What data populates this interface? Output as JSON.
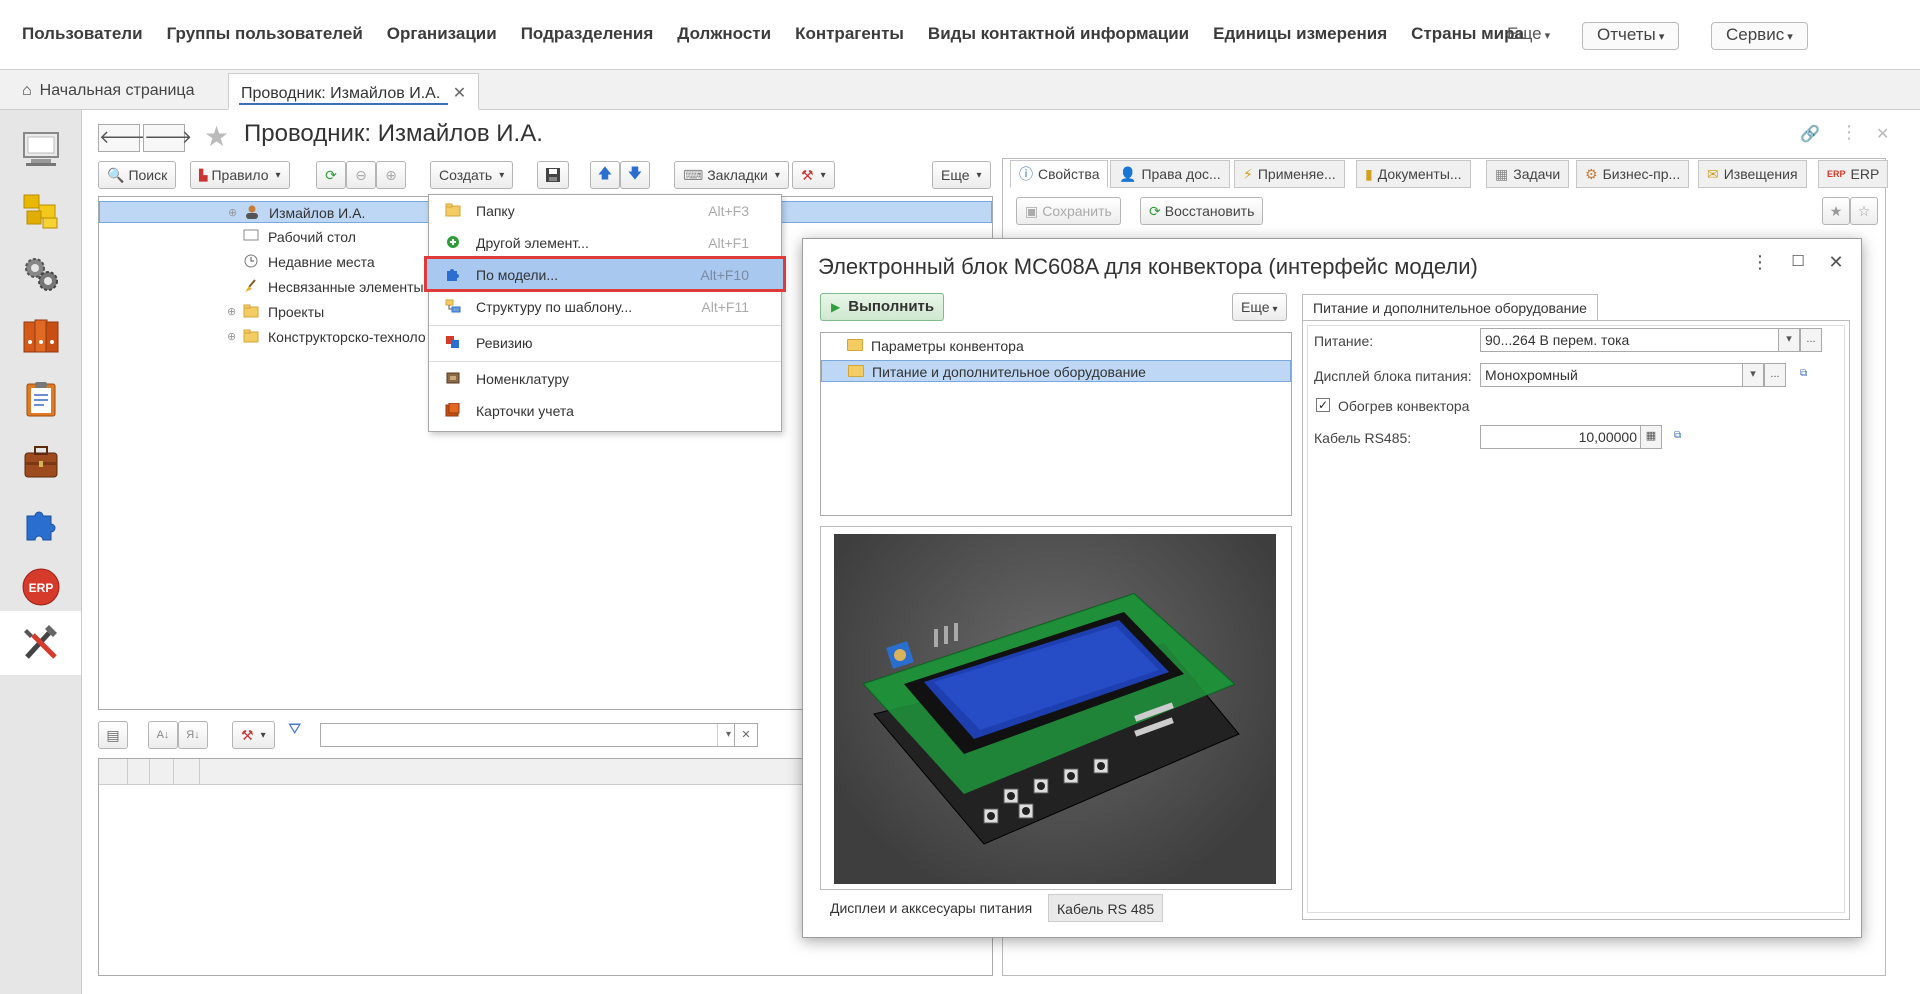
{
  "topmenu": {
    "items": [
      "Пользователи",
      "Группы пользователей",
      "Организации",
      "Подразделения",
      "Должности",
      "Контрагенты",
      "Виды контактной информации",
      "Единицы измерения",
      "Страны мира"
    ],
    "more_label": "Еще",
    "reports_label": "Отчеты",
    "service_label": "Сервис"
  },
  "window_tabs": {
    "home_label": "Начальная страница",
    "active_label": "Проводник: Измайлов И.А."
  },
  "sidebar": {
    "items": [
      {
        "icon": "desktop-icon"
      },
      {
        "icon": "cubes-icon"
      },
      {
        "icon": "gears-icon"
      },
      {
        "icon": "binders-icon"
      },
      {
        "icon": "clipboard-icon"
      },
      {
        "icon": "briefcase-icon"
      },
      {
        "icon": "puzzle-icon"
      },
      {
        "icon": "erp-icon",
        "label": "ERP"
      },
      {
        "icon": "tools-icon"
      }
    ]
  },
  "form": {
    "title": "Проводник: Измайлов И.А.",
    "toolbar": {
      "search_label": "Поиск",
      "rule_label": "Правило",
      "create_label": "Создать",
      "bookmarks_label": "Закладки",
      "more_label": "Еще"
    },
    "tree": [
      {
        "label": "Измайлов И.А.",
        "selected": true,
        "expandable": true
      },
      {
        "label": "Рабочий стол",
        "selected": false,
        "expandable": false
      },
      {
        "label": "Недавние места",
        "selected": false,
        "expandable": false
      },
      {
        "label": "Несвязанные элементы",
        "selected": false,
        "expandable": false
      },
      {
        "label": "Проекты",
        "selected": false,
        "expandable": true
      },
      {
        "label": "Конструкторско-техноло",
        "selected": false,
        "expandable": true
      }
    ],
    "filter_value": ""
  },
  "right_panel": {
    "tabs": [
      "Свойства",
      "Права дос...",
      "Применяе...",
      "Документы...",
      "Задачи",
      "Бизнес-пр...",
      "Извещения",
      "ERP"
    ],
    "save_label": "Сохранить",
    "restore_label": "Восстановить"
  },
  "create_menu": {
    "items": [
      {
        "label": "Папку",
        "shortcut": "Alt+F3",
        "icon": "folder-icon"
      },
      {
        "label": "Другой элемент...",
        "shortcut": "Alt+F1",
        "icon": "add-icon"
      },
      {
        "label": "По модели...",
        "shortcut": "Alt+F10",
        "icon": "puzzle-icon",
        "highlighted": true
      },
      {
        "label": "Структуру по шаблону...",
        "shortcut": "Alt+F11",
        "icon": "structure-icon"
      },
      {
        "label": "Ревизию",
        "shortcut": "",
        "icon": "revision-icon"
      },
      {
        "label": "Номенклатуру",
        "shortcut": "",
        "icon": "nomenclature-icon"
      },
      {
        "label": "Карточки учета",
        "shortcut": "",
        "icon": "cards-icon"
      }
    ]
  },
  "dialog": {
    "title": "Электронный блок MC608A для конвектора (интерфейс модели)",
    "run_label": "Выполнить",
    "more_label": "Еще",
    "params": [
      {
        "label": "Параметры конвентора",
        "selected": false
      },
      {
        "label": "Питание и дополнительное оборудование",
        "selected": true
      }
    ],
    "bottom_tabs": [
      "Дисплеи и акксесуары питания",
      "Кабель RS 485"
    ],
    "fields_tab": "Питание и дополнительное оборудование",
    "fields": {
      "power_label": "Питание:",
      "power_value": "90...264 В перем. тока",
      "display_label": "Дисплей блока питания:",
      "display_value": "Монохромный",
      "heating_label": "Обогрев конвектора",
      "heating_checked": true,
      "cable_label": "Кабель RS485:",
      "cable_value": "10,00000"
    }
  },
  "colors": {
    "selection": "#bdd7f5",
    "highlight_outline": "#e03b3b",
    "accent_blue": "#3b6fb7",
    "run_green": "#2f9e3a"
  }
}
